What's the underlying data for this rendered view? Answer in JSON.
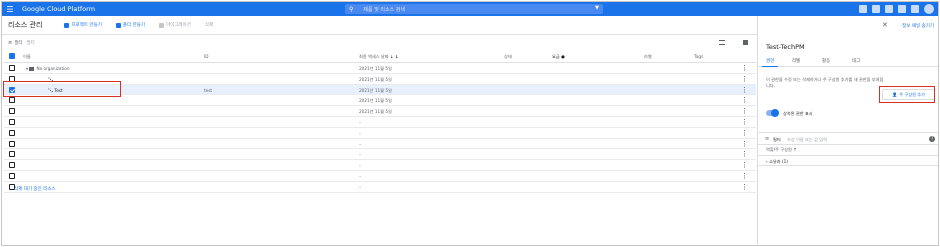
{
  "app": {
    "logo_text": "Google Cloud Platform",
    "search_placeholder": "제품 및 리소스 검색",
    "accent_color": "#1a73e8",
    "highlight_color": "#d93025"
  },
  "toolbar": {
    "page_title": "리소스 관리",
    "create_project": "프로젝트 만들기",
    "create_folder": "폴더 만들기",
    "migrate": "마이그레이션",
    "delete": "삭제"
  },
  "filter": {
    "label": "필터",
    "placeholder": "필터"
  },
  "table": {
    "columns": {
      "name": "이름",
      "id": "ID",
      "last_access": "최종 액세스 날짜",
      "status": "상태",
      "charges": "요금",
      "labels": "라벨",
      "tags": "Tags"
    },
    "rows": [
      {
        "name": "No organization",
        "id": "",
        "date": "2021년 11월 5일",
        "checked": false,
        "selected": false,
        "kind": "org"
      },
      {
        "name": "",
        "id": "",
        "date": "2021년 11월 5일",
        "checked": false,
        "selected": false,
        "kind": "node"
      },
      {
        "name": "Test",
        "id": "test",
        "date": "2021년 11월 5일",
        "checked": true,
        "selected": true,
        "kind": "node"
      },
      {
        "name": "",
        "id": "",
        "date": "2021년 11월 5일",
        "checked": false,
        "selected": false,
        "kind": "plain"
      },
      {
        "name": "",
        "id": "",
        "date": "2021년 11월 5일",
        "checked": false,
        "selected": false,
        "kind": "plain"
      },
      {
        "name": "",
        "id": "",
        "date": "–",
        "checked": false,
        "selected": false,
        "kind": "plain"
      },
      {
        "name": "",
        "id": "",
        "date": "–",
        "checked": false,
        "selected": false,
        "kind": "plain"
      },
      {
        "name": "",
        "id": "",
        "date": "–",
        "checked": false,
        "selected": false,
        "kind": "plain"
      },
      {
        "name": "",
        "id": "",
        "date": "–",
        "checked": false,
        "selected": false,
        "kind": "plain"
      },
      {
        "name": "",
        "id": "",
        "date": "–",
        "checked": false,
        "selected": false,
        "kind": "plain"
      },
      {
        "name": "",
        "id": "",
        "date": "–",
        "checked": false,
        "selected": false,
        "kind": "plain"
      },
      {
        "name": "",
        "id": "",
        "date": "–",
        "checked": false,
        "selected": false,
        "kind": "plain"
      }
    ],
    "pending_deletion": "삭제 대기 중인 리소스"
  },
  "panel": {
    "hide_info": "정보 패널 숨기기",
    "title": "Test-TechPM",
    "tabs": [
      "권한",
      "라벨",
      "활동",
      "태그"
    ],
    "description": "이 권한을 수정 또는 삭제하거나 주 구성원 추가를 새 권한을 부여합니다.",
    "add_member": "주 구성원 추가",
    "toggle_label": "상속된 권한 표시",
    "filter_label": "필터",
    "filter_placeholder": "속성 이름 또는 값 입력",
    "role_header": "역할/주 구성원",
    "role_row": "소유자 (1)"
  }
}
